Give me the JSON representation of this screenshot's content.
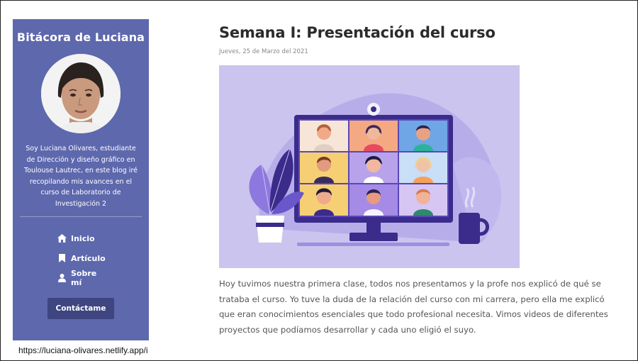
{
  "sidebar": {
    "blog_title": "Bitácora de Luciana",
    "bio": "Soy Luciana Olivares, estudiante de Dirección y diseño gráfico en Toulouse Lautrec, en este blog iré recopilando mis avances en el curso de Laboratorio de Investigación 2",
    "nav": [
      {
        "label": "Inicio",
        "icon": "home-icon"
      },
      {
        "label": "Artículo",
        "icon": "bookmark-icon"
      },
      {
        "label": "Sobre mí",
        "icon": "user-icon"
      }
    ],
    "contact_label": "Contáctame",
    "colors": {
      "background": "#5e68ad",
      "button": "#3e4580"
    }
  },
  "post": {
    "title": "Semana I: Presentación del curso",
    "date": "Jueves, 25 de Marzo del 2021",
    "image_icon": "video-call-illustration",
    "body": "Hoy tuvimos nuestra primera clase, todos nos presentamos y la profe nos explicó de qué se trataba el curso. Yo tuve la duda de la relación del curso con mi carrera, pero ella me explicó que eran conocimientos esenciales que todo profesional necesita. Vimos videos de diferentes proyectos que podíamos desarrollar y cada uno eligió el suyo."
  },
  "status_bar": {
    "url": "https://luciana-olivares.netlify.app/i"
  }
}
